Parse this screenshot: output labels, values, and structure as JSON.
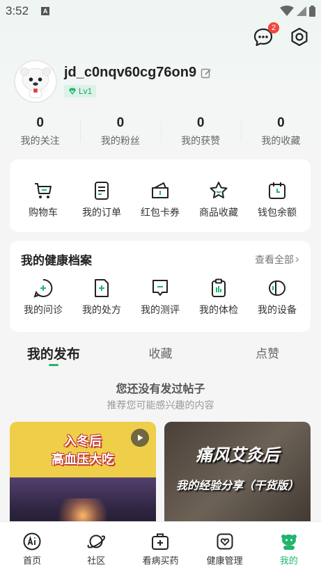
{
  "status_bar": {
    "time": "3:52",
    "notification_icon": "a-icon"
  },
  "header": {
    "message_badge": "2"
  },
  "profile": {
    "username": "jd_c0nqv60cg76on9",
    "level": "Lv1"
  },
  "stats": [
    {
      "value": "0",
      "label": "我的关注"
    },
    {
      "value": "0",
      "label": "我的粉丝"
    },
    {
      "value": "0",
      "label": "我的获赞"
    },
    {
      "value": "0",
      "label": "我的收藏"
    }
  ],
  "quick_actions": [
    {
      "label": "购物车",
      "icon": "cart-icon"
    },
    {
      "label": "我的订单",
      "icon": "order-icon"
    },
    {
      "label": "红包卡券",
      "icon": "wallet-coupon-icon"
    },
    {
      "label": "商品收藏",
      "icon": "star-icon"
    },
    {
      "label": "钱包余额",
      "icon": "calendar-wallet-icon"
    }
  ],
  "health": {
    "title": "我的健康档案",
    "view_all": "查看全部",
    "items": [
      {
        "label": "我的问诊",
        "icon": "consult-icon"
      },
      {
        "label": "我的处方",
        "icon": "prescription-icon"
      },
      {
        "label": "我的测评",
        "icon": "assessment-icon"
      },
      {
        "label": "我的体检",
        "icon": "checkup-icon"
      },
      {
        "label": "我的设备",
        "icon": "device-icon"
      }
    ]
  },
  "tabs": [
    {
      "label": "我的发布"
    },
    {
      "label": "收藏"
    },
    {
      "label": "点赞"
    }
  ],
  "empty_state": {
    "title": "您还没有发过帖子",
    "subtitle": "推荐您可能感兴趣的内容"
  },
  "recommendations": [
    {
      "line1": "入冬后",
      "line2": "高血压大吃"
    },
    {
      "line1": "痛风艾灸后",
      "line2": "我的经验分享（干货版）"
    }
  ],
  "bottom_nav": [
    {
      "label": "首页",
      "icon": "ai-home-icon"
    },
    {
      "label": "社区",
      "icon": "planet-icon"
    },
    {
      "label": "看病买药",
      "icon": "medical-bag-icon"
    },
    {
      "label": "健康管理",
      "icon": "health-heart-icon"
    },
    {
      "label": "我的",
      "icon": "mascot-icon"
    }
  ],
  "colors": {
    "accent": "#20b56d",
    "badge": "#f2453d"
  }
}
